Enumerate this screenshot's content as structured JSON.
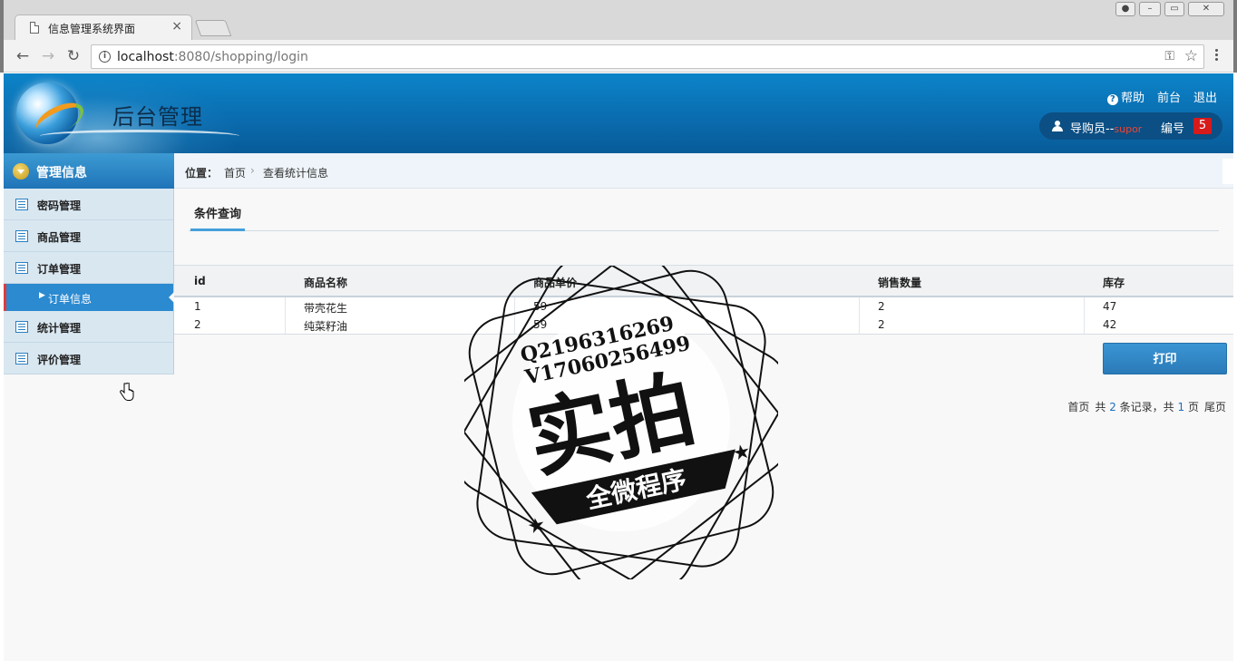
{
  "browser": {
    "tab_title": "信息管理系统界面",
    "tab_close": "×",
    "url_host": "localhost",
    "url_rest": ":8080/shopping/login",
    "back": "←",
    "forward": "→",
    "reload": "↻"
  },
  "header": {
    "title": "后台管理",
    "links": {
      "help": "帮助",
      "front": "前台",
      "logout": "退出"
    },
    "user": {
      "role_label": "导购员--",
      "username": "supor",
      "number_label": "编号",
      "number": "5"
    }
  },
  "sidebar": {
    "heading": "管理信息",
    "items": [
      {
        "label": "密码管理"
      },
      {
        "label": "商品管理"
      },
      {
        "label": "订单管理"
      },
      {
        "label": "统计管理"
      },
      {
        "label": "评价管理"
      }
    ],
    "sub_item": {
      "label": "订单信息"
    }
  },
  "main": {
    "breadcrumb": {
      "label": "位置：",
      "home": "首页",
      "current": "查看统计信息"
    },
    "tab": "条件查询",
    "table": {
      "headers": [
        "id",
        "商品名称",
        "商品单价",
        "销售数量",
        "库存"
      ],
      "rows": [
        [
          "1",
          "带壳花生",
          "59",
          "2",
          "47"
        ],
        [
          "2",
          "纯菜籽油",
          "59",
          "2",
          "42"
        ]
      ]
    },
    "print_button": "打印",
    "pager": {
      "first": "首页",
      "total_prefix": "共",
      "total_count": "2",
      "total_suffix": "条记录，共",
      "page_count": "1",
      "page_suffix": "页",
      "last": "尾页"
    }
  },
  "watermark": {
    "line1": "Q2196316269",
    "line2": "V17060256499",
    "big": "实拍",
    "banner": "全微程序"
  }
}
